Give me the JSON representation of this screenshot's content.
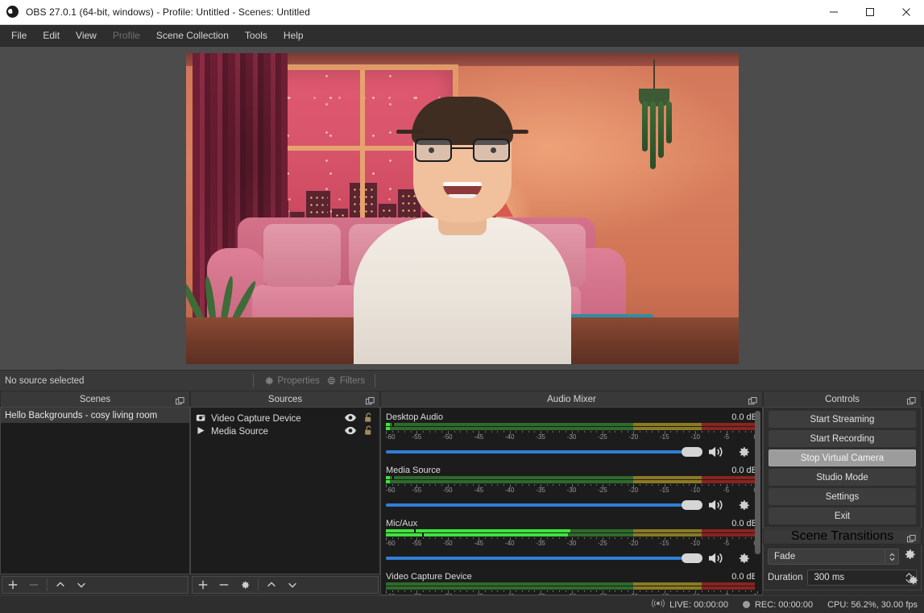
{
  "window": {
    "title": "OBS 27.0.1 (64-bit, windows) - Profile: Untitled - Scenes: Untitled",
    "app_icon": "obs-logo-icon",
    "minimize": "minimize-icon",
    "maximize": "maximize-icon",
    "close": "close-icon"
  },
  "menubar": {
    "items": [
      {
        "label": "File",
        "disabled": false
      },
      {
        "label": "Edit",
        "disabled": false
      },
      {
        "label": "View",
        "disabled": false
      },
      {
        "label": "Profile",
        "disabled": true
      },
      {
        "label": "Scene Collection",
        "disabled": false
      },
      {
        "label": "Tools",
        "disabled": false
      },
      {
        "label": "Help",
        "disabled": false
      }
    ]
  },
  "source_toolbar": {
    "status": "No source selected",
    "properties_label": "Properties",
    "properties_icon": "gear-icon",
    "filters_label": "Filters",
    "filters_icon": "filters-icon"
  },
  "scenes": {
    "title": "Scenes",
    "float_icon": "undock-icon",
    "items": [
      {
        "label": "Hello Backgrounds - cosy living room",
        "selected": true
      }
    ],
    "toolbar": [
      {
        "name": "add-scene-button",
        "icon": "plus-icon",
        "disabled": false
      },
      {
        "name": "remove-scene-button",
        "icon": "minus-icon",
        "disabled": true
      },
      {
        "name": "move-scene-up-button",
        "icon": "chevron-up-icon",
        "disabled": false
      },
      {
        "name": "move-scene-down-button",
        "icon": "chevron-down-icon",
        "disabled": false
      }
    ]
  },
  "sources": {
    "title": "Sources",
    "float_icon": "undock-icon",
    "items": [
      {
        "label": "Video Capture Device",
        "type_icon": "camera-icon",
        "visible_icon": "eye-icon",
        "lock_icon": "unlock-icon"
      },
      {
        "label": "Media Source",
        "type_icon": "play-icon",
        "visible_icon": "eye-icon",
        "lock_icon": "unlock-icon"
      }
    ],
    "toolbar": [
      {
        "name": "add-source-button",
        "icon": "plus-icon",
        "disabled": false
      },
      {
        "name": "remove-source-button",
        "icon": "minus-icon",
        "disabled": false
      },
      {
        "name": "source-properties-button",
        "icon": "gear-icon",
        "disabled": false
      },
      {
        "name": "move-source-up-button",
        "icon": "chevron-up-icon",
        "disabled": false
      },
      {
        "name": "move-source-down-button",
        "icon": "chevron-down-icon",
        "disabled": false
      }
    ]
  },
  "mixer": {
    "title": "Audio Mixer",
    "float_icon": "undock-icon",
    "scale_min": -60,
    "scale_max": 0,
    "tick_labels": [
      "-60",
      "-55",
      "-50",
      "-45",
      "-40",
      "-35",
      "-30",
      "-25",
      "-20",
      "-15",
      "-10",
      "-5",
      "0"
    ],
    "green_to": -20,
    "yellow_to": -9,
    "tracks": [
      {
        "name": "Desktop Audio",
        "db": "0.0 dB",
        "level_db": -59.4,
        "level2_db": -59.4,
        "peak_db": -59.0,
        "volume_pct": 100,
        "mute_icon": "speaker-icon",
        "settings_icon": "gear-icon"
      },
      {
        "name": "Media Source",
        "db": "0.0 dB",
        "level_db": -59.4,
        "level2_db": -59.4,
        "peak_db": -59.0,
        "volume_pct": 100,
        "mute_icon": "speaker-icon",
        "settings_icon": "gear-icon"
      },
      {
        "name": "Mic/Aux",
        "db": "0.0 dB",
        "level_db": -30.2,
        "level2_db": -30.6,
        "peak_db": -55.5,
        "peak2_db": -54.2,
        "volume_pct": 100,
        "mute_icon": "speaker-icon",
        "settings_icon": "gear-icon"
      },
      {
        "name": "Video Capture Device",
        "db": "0.0 dB",
        "level_db": -60,
        "level2_db": -60,
        "volume_pct": 100,
        "mute_icon": "speaker-icon",
        "settings_icon": "gear-icon"
      }
    ]
  },
  "controls": {
    "title": "Controls",
    "float_icon": "undock-icon",
    "buttons": [
      {
        "label": "Start Streaming",
        "state": "normal"
      },
      {
        "label": "Start Recording",
        "state": "normal"
      },
      {
        "label": "Stop Virtual Camera",
        "state": "highlighted"
      },
      {
        "label": "Studio Mode",
        "state": "normal"
      },
      {
        "label": "Settings",
        "state": "normal"
      },
      {
        "label": "Exit",
        "state": "normal"
      }
    ]
  },
  "transitions": {
    "title": "Scene Transitions",
    "float_icon": "undock-icon",
    "transition": "Fade",
    "transition_spin_icon": "spinner-updown-icon",
    "config_icon": "gear-icon",
    "duration_label": "Duration",
    "duration_value": "300 ms",
    "duration_spin_icon": "spinner-updown-icon"
  },
  "statusbar": {
    "live_icon": "broadcast-icon",
    "live": "LIVE: 00:00:00",
    "rec_icon": "record-dot-icon",
    "rec": "REC: 00:00:00",
    "cpu": "CPU: 56.2%, 30.00 fps"
  },
  "preview": {
    "description": "Webcam preview with virtual cosy living room background"
  },
  "colors": {
    "accent_blue": "#2f7fd6",
    "meter_green": "#2f6a2b",
    "meter_green_active": "#3ee43e",
    "meter_yellow": "#8a7a24",
    "meter_red": "#8a2420",
    "panel_bg": "#2e2e2e",
    "dock_bg": "#1c1c1c",
    "titlebar_bg": "#ffffff"
  }
}
